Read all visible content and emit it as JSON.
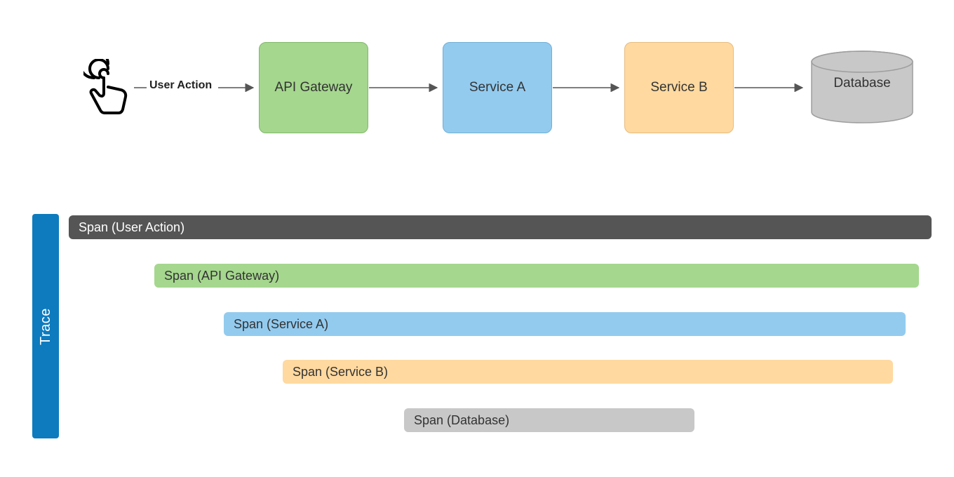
{
  "flow": {
    "user_action_label": "User Action",
    "nodes": {
      "api_gateway": "API Gateway",
      "service_a": "Service A",
      "service_b": "Service B",
      "database": "Database"
    }
  },
  "trace": {
    "label": "Trace",
    "spans": [
      {
        "label": "Span (User Action)",
        "color": "#555555",
        "text_color": "#fff"
      },
      {
        "label": "Span (API Gateway)",
        "color": "#A5D78E",
        "text_color": "#333"
      },
      {
        "label": "Span (Service A)",
        "color": "#93CBEF",
        "text_color": "#333"
      },
      {
        "label": "Span (Service B)",
        "color": "#FFD9A0",
        "text_color": "#333"
      },
      {
        "label": "Span (Database)",
        "color": "#C8C8C8",
        "text_color": "#333"
      }
    ]
  },
  "colors": {
    "api_gateway": "#A5D78E",
    "service_a": "#93CBEF",
    "service_b": "#FFD9A0",
    "database": "#C8C8C8",
    "trace_bar": "#0D7BBE",
    "user_action_span": "#555555"
  }
}
